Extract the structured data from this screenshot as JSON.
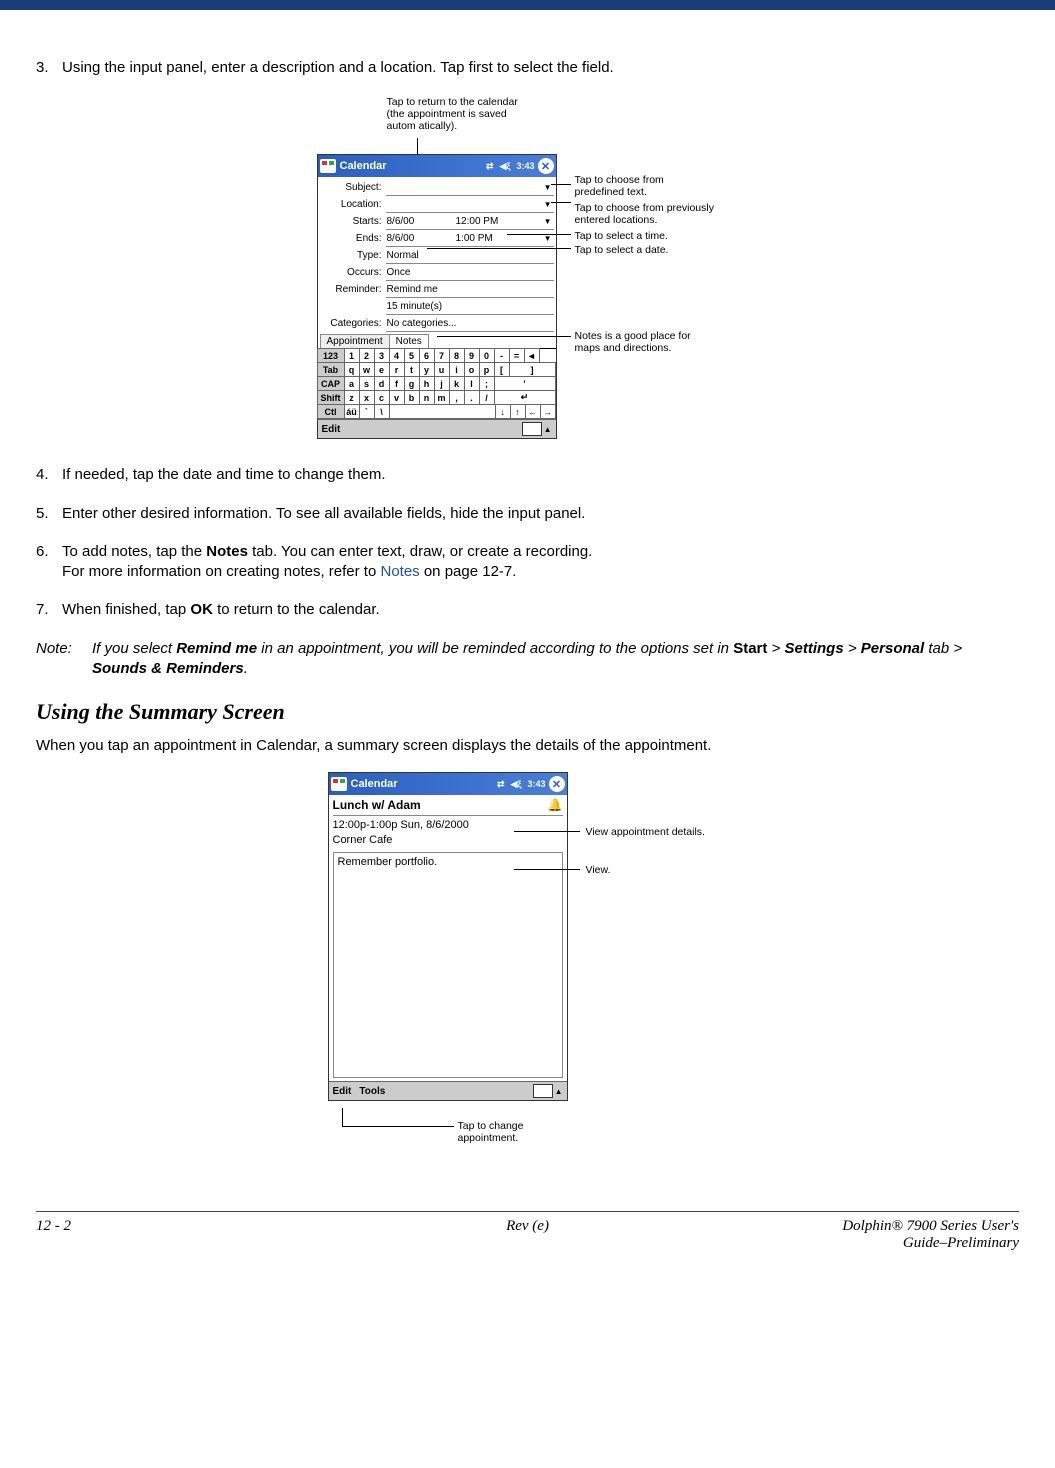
{
  "steps": {
    "s3": {
      "num": "3.",
      "text": "Using the input panel, enter a description and a location. Tap first to select the field."
    },
    "s4": {
      "num": "4.",
      "text": "If needed, tap the date and time to change them."
    },
    "s5": {
      "num": "5.",
      "text": "Enter other desired information. To see all available fields, hide the input panel."
    },
    "s6": {
      "num": "6.",
      "text_before": "To add notes, tap the ",
      "bold1": "Notes",
      "text_mid": " tab. You can enter text, draw, or create a recording.",
      "line2_before": "For more information on creating notes, refer to ",
      "link": "Notes",
      "line2_after": " on page 12-7."
    },
    "s7": {
      "num": "7.",
      "text_before": "When finished, tap ",
      "bold": "OK",
      "text_after": " to return to the calendar."
    }
  },
  "note": {
    "label": "Note:",
    "p1": "If you select ",
    "b1": "Remind me",
    "p2": " in an appointment, you will be reminded according to the options set in ",
    "r1": "Start",
    "p3": " > ",
    "b2": "Settings",
    "p4": " > ",
    "b3": "Personal",
    "p5": " tab > ",
    "b4": "Sounds & Reminders",
    "p6": "."
  },
  "section_heading": "Using the Summary Screen",
  "section_text": "When you tap an appointment in Calendar, a summary screen displays the details of the appointment.",
  "device1": {
    "title": "Calendar",
    "time_status": "3:43",
    "fields": {
      "subject": {
        "label": "Subject:",
        "value": ""
      },
      "location": {
        "label": "Location:",
        "value": ""
      },
      "starts": {
        "label": "Starts:",
        "date": "8/6/00",
        "time": "12:00 PM"
      },
      "ends": {
        "label": "Ends:",
        "date": "8/6/00",
        "time": "1:00 PM"
      },
      "type": {
        "label": "Type:",
        "value": "Normal"
      },
      "occurs": {
        "label": "Occurs:",
        "value": "Once"
      },
      "reminder": {
        "label": "Reminder:",
        "value": "Remind me"
      },
      "reminder2": {
        "label": "",
        "value": "15   minute(s)"
      },
      "categories": {
        "label": "Categories:",
        "value": "No categories..."
      }
    },
    "tabs": {
      "appointment": "Appointment",
      "notes": "Notes"
    },
    "edit_label": "Edit",
    "keyboard": [
      [
        "123",
        "1",
        "2",
        "3",
        "4",
        "5",
        "6",
        "7",
        "8",
        "9",
        "0",
        "-",
        "=",
        "◄"
      ],
      [
        "Tab",
        "q",
        "w",
        "e",
        "r",
        "t",
        "y",
        "u",
        "i",
        "o",
        "p",
        "[",
        "]"
      ],
      [
        "CAP",
        "a",
        "s",
        "d",
        "f",
        "g",
        "h",
        "j",
        "k",
        "l",
        ";",
        "'"
      ],
      [
        "Shift",
        "z",
        "x",
        "c",
        "v",
        "b",
        "n",
        "m",
        ",",
        ".",
        "/",
        "↵"
      ],
      [
        "Ctl",
        "áü",
        "`",
        "\\",
        " ",
        "↓",
        "↑",
        "←",
        "→"
      ]
    ]
  },
  "callouts1": {
    "top": "Tap to return to the calendar (the appointment is saved autom atically).",
    "subject": "Tap to choose from predefined text.",
    "location": "Tap to choose from previously entered locations.",
    "time": "Tap to select a time.",
    "date": "Tap to select a date.",
    "notes": "Notes is a good place for maps and directions."
  },
  "device2": {
    "title": "Calendar",
    "time_status": "3:43",
    "summary_title": "Lunch w/ Adam",
    "detail_line": "12:00p-1:00p Sun, 8/6/2000",
    "location": "Corner Cafe",
    "note_text": "Remember portfolio.",
    "bottom": {
      "edit": "Edit",
      "tools": "Tools"
    }
  },
  "callouts2": {
    "details": "View appointment details.",
    "view": "View.",
    "bottom": "Tap to change appointment."
  },
  "footer": {
    "left": "12 - 2",
    "center": "Rev (e)",
    "right1": "Dolphin® 7900 Series User's",
    "right2": "Guide–Preliminary"
  }
}
